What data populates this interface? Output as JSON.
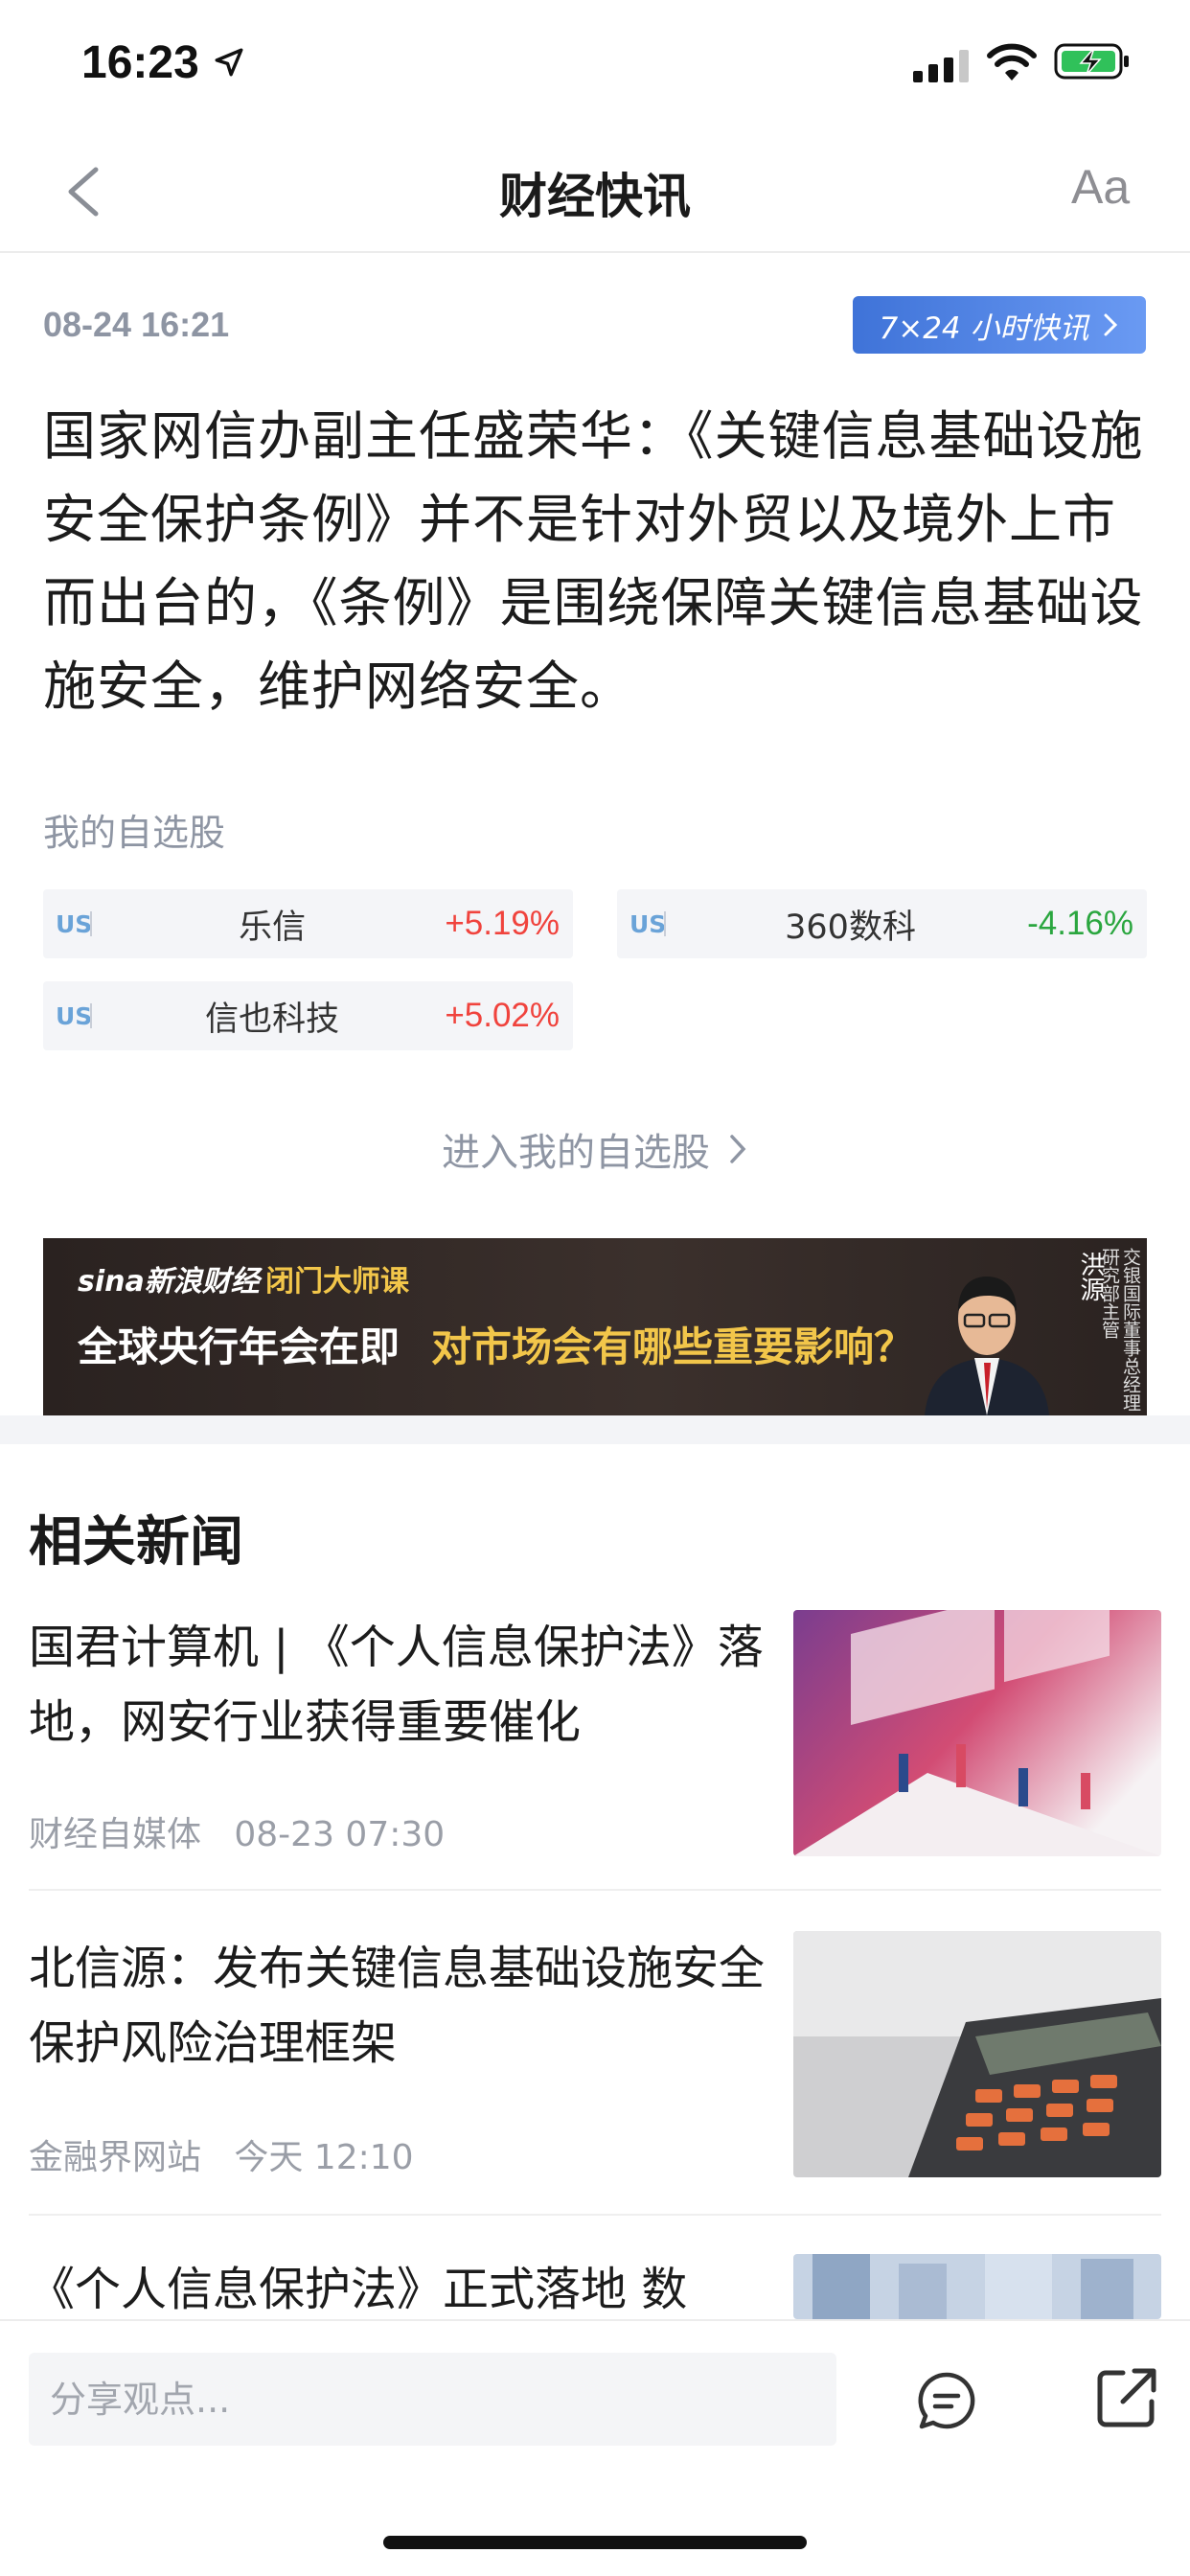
{
  "status_bar": {
    "time": "16:23",
    "icons": [
      "location-arrow-icon",
      "cellular-signal-icon",
      "wifi-icon",
      "battery-charging-icon"
    ]
  },
  "nav": {
    "title": "财经快讯",
    "font_button_label": "Aa",
    "icons": [
      "back-chevron-icon"
    ]
  },
  "article": {
    "time": "08-24 16:21",
    "badge_label": "7×24 小时快讯",
    "body": "国家网信办副主任盛荣华：《关键信息基础设施安全保护条例》并不是针对外贸以及境外上市而出台的，《条例》是围绕保障关键信息基础设施安全，维护网络安全。"
  },
  "watchlist": {
    "title": "我的自选股",
    "stocks": [
      {
        "market": "US",
        "name": "乐信",
        "change": "+5.19%",
        "direction": "up"
      },
      {
        "market": "US",
        "name": "360数科",
        "change": "-4.16%",
        "direction": "down"
      },
      {
        "market": "US",
        "name": "信也科技",
        "change": "+5.02%",
        "direction": "up"
      }
    ],
    "enter_label": "进入我的自选股",
    "colors": {
      "up": "#f0433d",
      "down": "#2aa63f"
    }
  },
  "banner": {
    "logo": "sina新浪财经",
    "series": "闭门大师课",
    "headline_a": "全球央行年会在即",
    "headline_b": "对市场会有哪些重要影响？",
    "person_name": "洪源",
    "person_role": "交银国际董事总经理研究部主管"
  },
  "related": {
    "title": "相关新闻",
    "items": [
      {
        "title": "国君计算机 | 《个人信息保护法》落地，网安行业获得重要催化",
        "source": "财经自媒体",
        "time": "08-23 07:30"
      },
      {
        "title": "北信源：发布关键信息基础设施安全保护风险治理框架",
        "source": "金融界网站",
        "time": "今天 12:10"
      },
      {
        "title": "《个人信息保护法》正式落地 数",
        "source": "",
        "time": ""
      }
    ]
  },
  "bottom_bar": {
    "input_placeholder": "分享观点...",
    "icons": [
      "comment-icon",
      "share-icon"
    ]
  },
  "colors": {
    "accent_blue": "#3f73d8",
    "text_gray": "#8e95a3"
  }
}
